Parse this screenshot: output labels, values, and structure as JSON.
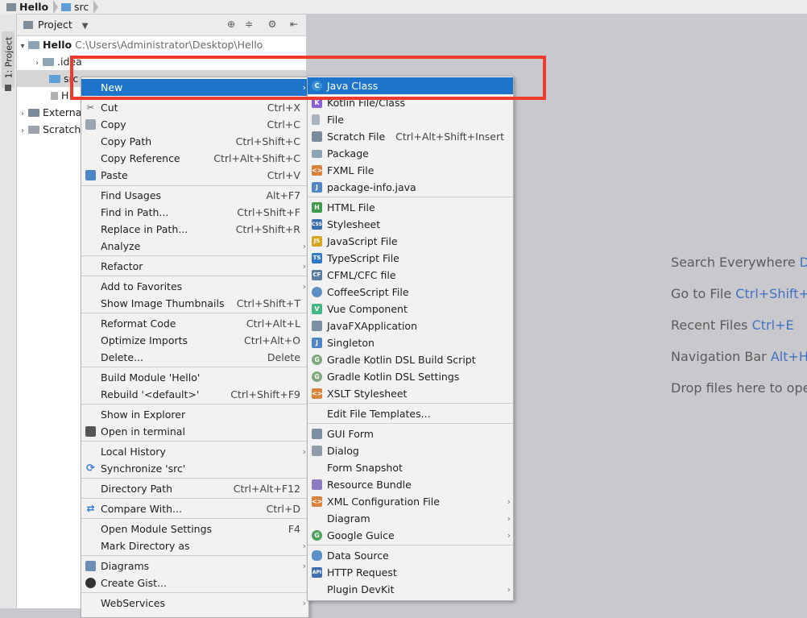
{
  "breadcrumb": [
    "Hello",
    "src"
  ],
  "project_panel": {
    "header": "Project",
    "tool_window_tab": "1: Project",
    "tree": [
      {
        "label": "Hello",
        "path": "C:\\Users\\Administrator\\Desktop\\Hello"
      },
      {
        "label": ".idea"
      },
      {
        "label": "src"
      },
      {
        "label": "H"
      },
      {
        "label": "Externa"
      },
      {
        "label": "Scratch"
      }
    ]
  },
  "context_menu": [
    {
      "label": "New",
      "shortcut": "",
      "submenu": true
    },
    {
      "label": "Cut",
      "shortcut": "Ctrl+X",
      "icon": "scissors-icon"
    },
    {
      "label": "Copy",
      "shortcut": "Ctrl+C",
      "icon": "copy-icon"
    },
    {
      "label": "Copy Path",
      "shortcut": "Ctrl+Shift+C"
    },
    {
      "label": "Copy Reference",
      "shortcut": "Ctrl+Alt+Shift+C"
    },
    {
      "label": "Paste",
      "shortcut": "Ctrl+V",
      "icon": "paste-icon"
    },
    {
      "label": "Find Usages",
      "shortcut": "Alt+F7"
    },
    {
      "label": "Find in Path...",
      "shortcut": "Ctrl+Shift+F"
    },
    {
      "label": "Replace in Path...",
      "shortcut": "Ctrl+Shift+R"
    },
    {
      "label": "Analyze",
      "shortcut": "",
      "submenu": true
    },
    {
      "label": "Refactor",
      "shortcut": "",
      "submenu": true
    },
    {
      "label": "Add to Favorites",
      "shortcut": "",
      "submenu": true
    },
    {
      "label": "Show Image Thumbnails",
      "shortcut": "Ctrl+Shift+T"
    },
    {
      "label": "Reformat Code",
      "shortcut": "Ctrl+Alt+L"
    },
    {
      "label": "Optimize Imports",
      "shortcut": "Ctrl+Alt+O"
    },
    {
      "label": "Delete...",
      "shortcut": "Delete"
    },
    {
      "label": "Build Module 'Hello'",
      "shortcut": ""
    },
    {
      "label": "Rebuild '<default>'",
      "shortcut": "Ctrl+Shift+F9"
    },
    {
      "label": "Show in Explorer",
      "shortcut": ""
    },
    {
      "label": "Open in terminal",
      "shortcut": "",
      "icon": "terminal-icon"
    },
    {
      "label": "Local History",
      "shortcut": "",
      "submenu": true
    },
    {
      "label": "Synchronize 'src'",
      "shortcut": "",
      "icon": "sync-icon"
    },
    {
      "label": "Directory Path",
      "shortcut": "Ctrl+Alt+F12"
    },
    {
      "label": "Compare With...",
      "shortcut": "Ctrl+D",
      "icon": "compare-icon"
    },
    {
      "label": "Open Module Settings",
      "shortcut": "F4"
    },
    {
      "label": "Mark Directory as",
      "shortcut": "",
      "submenu": true
    },
    {
      "label": "Diagrams",
      "shortcut": "",
      "submenu": true,
      "icon": "diagram-icon"
    },
    {
      "label": "Create Gist...",
      "shortcut": "",
      "icon": "github-icon"
    },
    {
      "label": "WebServices",
      "shortcut": "",
      "submenu": true
    }
  ],
  "new_submenu": [
    {
      "label": "Java Class",
      "shortcut": "",
      "icon": "java-class-icon",
      "badge": "C"
    },
    {
      "label": "Kotlin File/Class",
      "shortcut": "",
      "icon": "kotlin-icon",
      "badge": "K"
    },
    {
      "label": "File",
      "shortcut": "",
      "icon": "file-icon",
      "badge": ""
    },
    {
      "label": "Scratch File",
      "shortcut": "Ctrl+Alt+Shift+Insert",
      "icon": "scratch-file-icon",
      "badge": ""
    },
    {
      "label": "Package",
      "shortcut": "",
      "icon": "package-icon",
      "badge": ""
    },
    {
      "label": "FXML File",
      "shortcut": "",
      "icon": "fxml-icon",
      "badge": "<>"
    },
    {
      "label": "package-info.java",
      "shortcut": "",
      "icon": "package-info-icon",
      "badge": "J"
    },
    {
      "label": "HTML File",
      "shortcut": "",
      "icon": "html-icon",
      "badge": "H"
    },
    {
      "label": "Stylesheet",
      "shortcut": "",
      "icon": "css-icon",
      "badge": "CSS"
    },
    {
      "label": "JavaScript File",
      "shortcut": "",
      "icon": "js-icon",
      "badge": "JS"
    },
    {
      "label": "TypeScript File",
      "shortcut": "",
      "icon": "ts-icon",
      "badge": "TS"
    },
    {
      "label": "CFML/CFC file",
      "shortcut": "",
      "icon": "cfml-icon",
      "badge": "CF"
    },
    {
      "label": "CoffeeScript File",
      "shortcut": "",
      "icon": "coffeescript-icon",
      "badge": ""
    },
    {
      "label": "Vue Component",
      "shortcut": "",
      "icon": "vue-icon",
      "badge": "V"
    },
    {
      "label": "JavaFXApplication",
      "shortcut": "",
      "icon": "javafx-icon",
      "badge": ""
    },
    {
      "label": "Singleton",
      "shortcut": "",
      "icon": "singleton-icon",
      "badge": "J"
    },
    {
      "label": "Gradle Kotlin DSL Build Script",
      "shortcut": "",
      "icon": "gradle-icon",
      "badge": "G"
    },
    {
      "label": "Gradle Kotlin DSL Settings",
      "shortcut": "",
      "icon": "gradle-icon",
      "badge": "G"
    },
    {
      "label": "XSLT Stylesheet",
      "shortcut": "",
      "icon": "xslt-icon",
      "badge": "<>"
    },
    {
      "label": "Edit File Templates...",
      "shortcut": "",
      "badge": ""
    },
    {
      "label": "GUI Form",
      "shortcut": "",
      "icon": "gui-form-icon",
      "badge": ""
    },
    {
      "label": "Dialog",
      "shortcut": "",
      "icon": "dialog-icon",
      "badge": ""
    },
    {
      "label": "Form Snapshot",
      "shortcut": "",
      "badge": ""
    },
    {
      "label": "Resource Bundle",
      "shortcut": "",
      "icon": "resource-bundle-icon",
      "badge": ""
    },
    {
      "label": "XML Configuration File",
      "shortcut": "",
      "icon": "xml-icon",
      "badge": "<>",
      "submenu": true
    },
    {
      "label": "Diagram",
      "shortcut": "",
      "badge": "",
      "submenu": true
    },
    {
      "label": "Google Guice",
      "shortcut": "",
      "icon": "guice-icon",
      "badge": "G",
      "submenu": true
    },
    {
      "label": "Data Source",
      "shortcut": "",
      "icon": "database-icon",
      "badge": ""
    },
    {
      "label": "HTTP Request",
      "shortcut": "",
      "icon": "api-icon",
      "badge": "API"
    },
    {
      "label": "Plugin DevKit",
      "shortcut": "",
      "badge": "",
      "submenu": true
    }
  ],
  "editor_hints": [
    {
      "text": "Search Everywhere",
      "key": "Do"
    },
    {
      "text": "Go to File",
      "key": "Ctrl+Shift+N"
    },
    {
      "text": "Recent Files",
      "key": "Ctrl+E"
    },
    {
      "text": "Navigation Bar",
      "key": "Alt+Ho"
    },
    {
      "text": "Drop files here to oper",
      "key": ""
    }
  ],
  "colors": {
    "highlight": "#1e74c9",
    "annotation": "#ef3b2c"
  }
}
